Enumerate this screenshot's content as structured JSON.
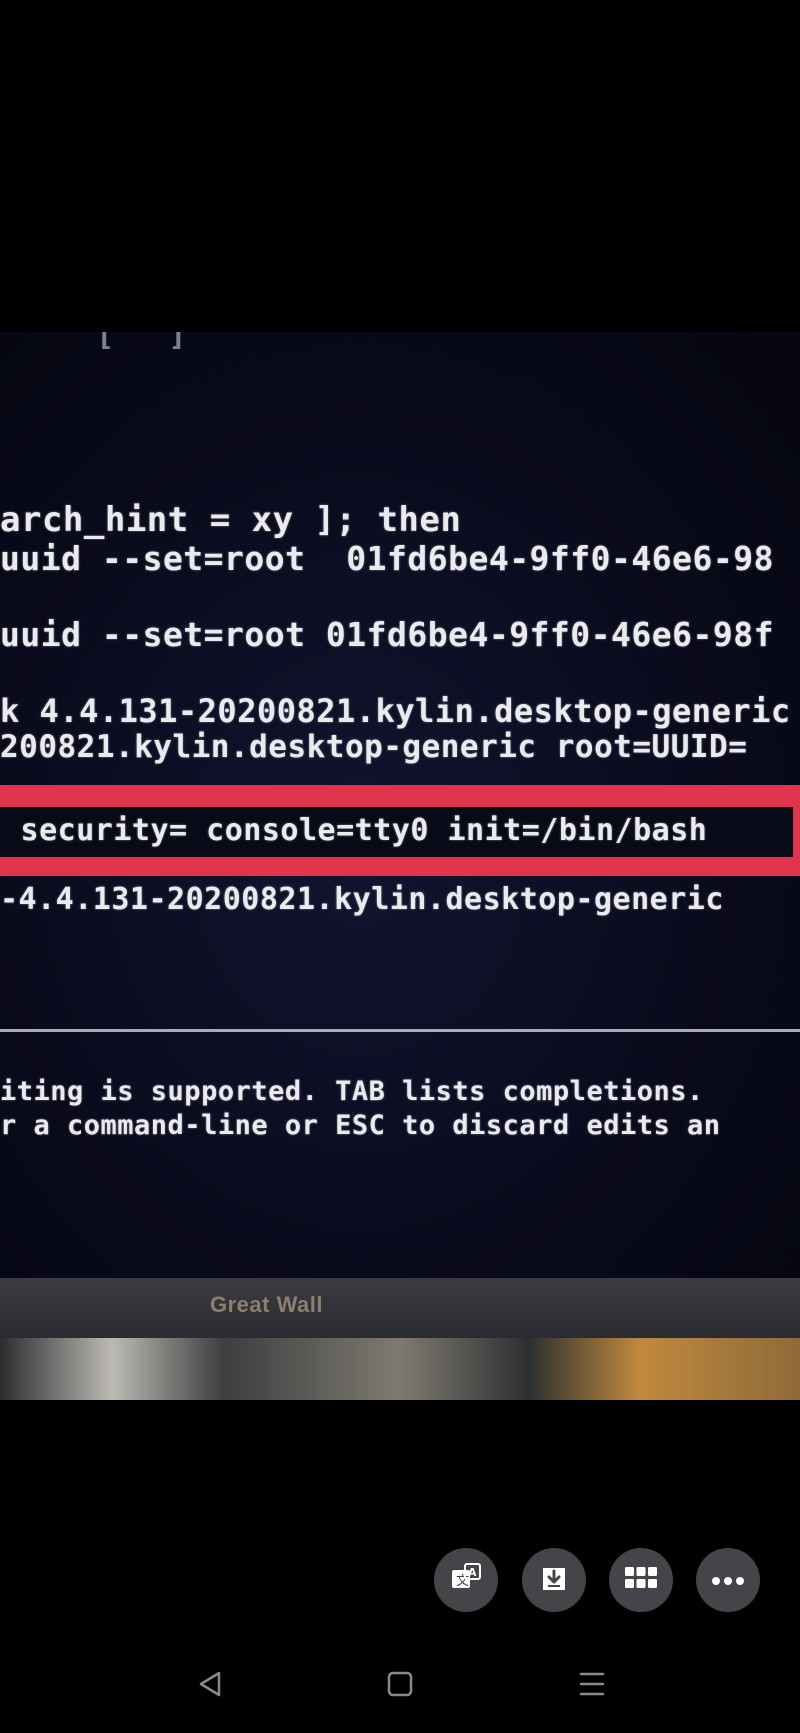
{
  "terminal": {
    "top_fragment": "  [   ]          ",
    "lines": [
      "arch_hint = xy ]; then",
      "uuid --set=root  01fd6be4-9ff0-46e6-98",
      "uuid --set=root 01fd6be4-9ff0-46e6-98f",
      "k 4.4.131-20200821.kylin.desktop-generic",
      "200821.kylin.desktop-generic root=UUID=",
      "-4.4.131-20200821.kylin.desktop-generic",
      "iting is supported. TAB lists completions.",
      "r a command-line or ESC to discard edits an"
    ],
    "highlighted_line": " security= console=tty0 init=/bin/bash",
    "highlight_color": "#e0334c"
  },
  "monitor": {
    "brand": "Great Wall"
  },
  "viewer_actions": {
    "translate_icon": "translate-icon",
    "download_icon": "download-icon",
    "grid_icon": "grid-icon",
    "more_icon": "more-icon"
  },
  "navigation": {
    "back_icon": "back-triangle-icon",
    "home_icon": "home-square-icon",
    "menu_icon": "menu-lines-icon"
  }
}
